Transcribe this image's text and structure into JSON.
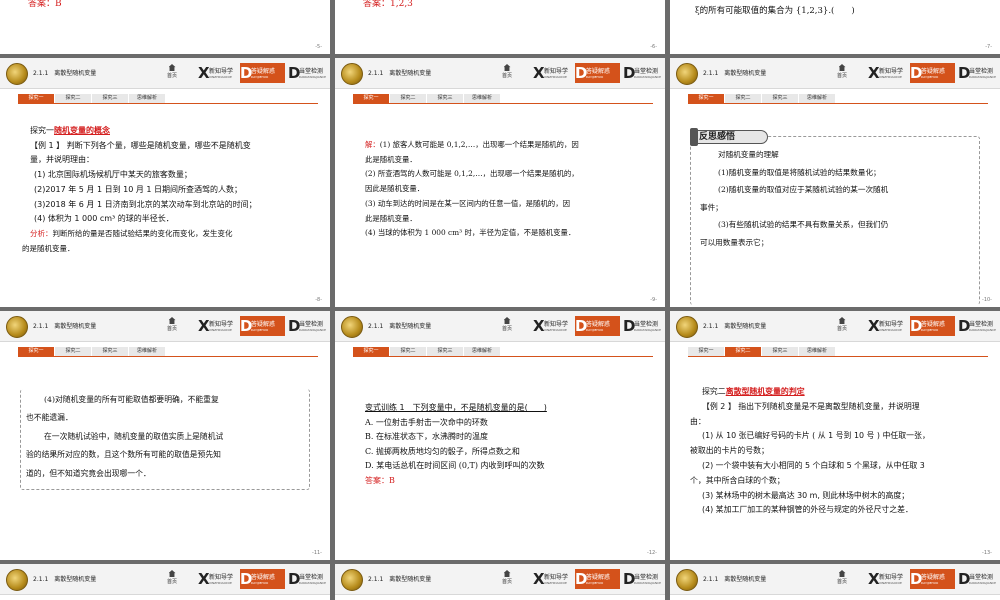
{
  "header": {
    "lesson_title": "2.1.1　离散型随机变量",
    "home_label": "首页",
    "nav": [
      {
        "letter": "X",
        "title": "新知导学",
        "sub": "XINZHIDAOXUE"
      },
      {
        "letter": "D",
        "title": "答疑解惑",
        "sub": "DAYIJIEHUO"
      },
      {
        "letter": "D",
        "title": "当堂检测",
        "sub": "DANGTANGJIANCE"
      }
    ]
  },
  "tabs": [
    "探究一",
    "探究二",
    "探究三",
    "思维解析"
  ],
  "slides": {
    "s5": {
      "page": "-5-",
      "text": "答案：B"
    },
    "s6": {
      "page": "-6-",
      "text": "答案：1,2,3"
    },
    "s7": {
      "page": "-7-",
      "text": "ξ的所有可能取值的集合为 {1,2,3}.(　　)"
    },
    "s8": {
      "page": "-8-",
      "heading_prefix": "探究一",
      "heading_red": "随机变量的概念",
      "lines": [
        "【例 1 】 判断下列各个量，哪些是随机变量，哪些不是随机变",
        "量，并说明理由：",
        "(1) 北京国际机场候机厅中某天的旅客数量；",
        "(2)2017 年 5 月 1 日到 10 月 1 日期间所查酒驾的人数；",
        "(3)2018 年 6 月 1 日济南到北京的某次动车到北京站的时间；",
        "(4) 体积为 1 000 cm³ 的球的半径长．"
      ],
      "analysis_label": "分析：",
      "analysis": "判断所给的量是否随试验结果的变化而变化，发生变化",
      "analysis2": "的是随机变量．"
    },
    "s9": {
      "page": "-9-",
      "label": "解：",
      "lines": [
        "(1) 旅客人数可能是 0,1,2,…，出现哪一个结果是随机的，因",
        "此是随机变量．",
        "(2) 所查酒驾的人数可能是 0,1,2,…，出现哪一个结果是随机的，",
        "因此是随机变量．",
        "(3) 动车到达的时间是在某一区间内的任意一值，是随机的，因",
        "此是随机变量．",
        "(4) 当球的体积为 1 000 cm³ 时，半径为定值，不是随机变量．"
      ]
    },
    "s10": {
      "page": "-10-",
      "tag": "反思感悟",
      "lines": [
        "对随机变量的理解",
        "(1)随机变量的取值是将随机试验的结果数量化；",
        "(2)随机变量的取值对应于某随机试验的某一次随机",
        "事件；",
        "(3)有些随机试验的结果不具有数量关系，但我们仍",
        "可以用数量表示它；"
      ]
    },
    "s11": {
      "page": "-11-",
      "lines": [
        "(4)对随机变量的所有可能取值都要明确，不能重复",
        "也不能遗漏．",
        "在一次随机试验中，随机变量的取值实质上是随机试",
        "验的结果所对应的数，且这个数所有可能的取值是预先知",
        "道的，但不知道究竟会出现哪一个．"
      ]
    },
    "s12": {
      "page": "-12-",
      "title": "变式训练 1　下列变量中，不是随机变量的是(　　)",
      "options": [
        "A. 一位射击手射击一次命中的环数",
        "B. 在标准状态下，水沸腾时的温度",
        "C. 抛掷两枚质地均匀的骰子，所得点数之和",
        "D. 某电话总机在时间区间 (0,T) 内收到呼叫的次数"
      ],
      "answer": "答案：B"
    },
    "s13": {
      "page": "-13-",
      "heading_prefix": "探究二",
      "heading_red": "离散型随机变量的判定",
      "lines": [
        "【例 2 】 指出下列随机变量是不是离散型随机变量，并说明理",
        "由：",
        "(1) 从 10 张已编好号码的卡片 ( 从 1 号到 10 号 ) 中任取一张，",
        "被取出的卡片的号数；",
        "(2) 一个袋中装有大小相同的 5 个白球和 5 个黑球，从中任取 3",
        "个，其中所含白球的个数；",
        "(3) 某林场中的树木最高达 30 m, 则此林场中树木的高度；",
        "(4) 某加工厂加工的某种钢管的外径与规定的外径尺寸之差．"
      ]
    }
  }
}
